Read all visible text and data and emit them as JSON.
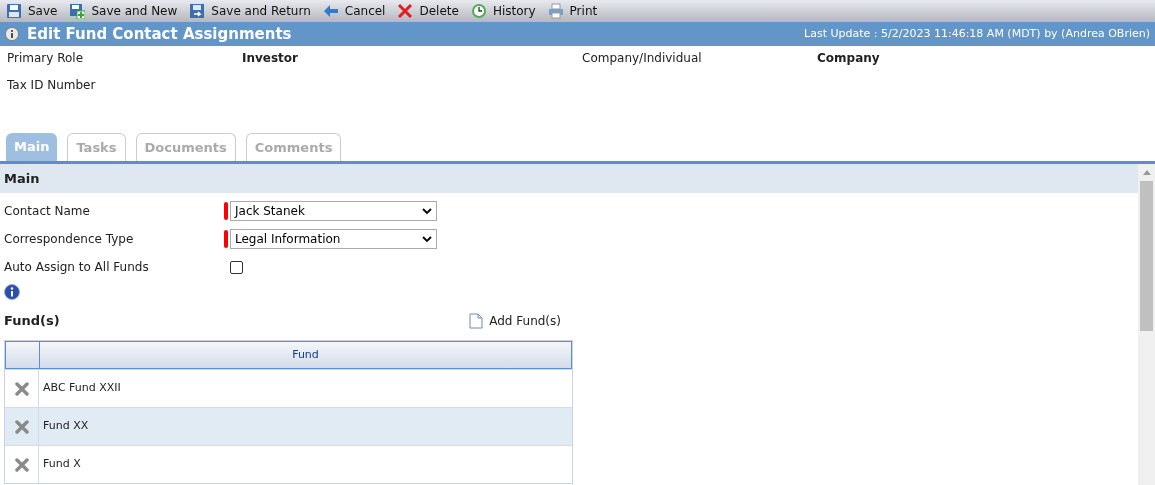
{
  "toolbar": [
    {
      "kind": "save",
      "label": "Save"
    },
    {
      "kind": "save_new",
      "label": "Save and New"
    },
    {
      "kind": "save_return",
      "label": "Save and Return"
    },
    {
      "kind": "cancel",
      "label": "Cancel"
    },
    {
      "kind": "delete",
      "label": "Delete"
    },
    {
      "kind": "history",
      "label": "History"
    },
    {
      "kind": "print",
      "label": "Print"
    }
  ],
  "title": "Edit Fund Contact Assignments",
  "last_update": "Last Update : 5/2/2023 11:46:18 AM (MDT) by (Andrea OBrien)",
  "info": [
    {
      "label": "Primary Role",
      "value": "Investor"
    },
    {
      "label": "Company/Individual",
      "value": "Company"
    },
    {
      "label": "Tax ID Number"
    }
  ],
  "tabs": [
    {
      "label": "Main",
      "selected": true
    },
    {
      "label": "Tasks",
      "selected": false
    },
    {
      "label": "Documents",
      "selected": false
    },
    {
      "label": "Comments",
      "selected": false
    }
  ],
  "section_title": "Main",
  "fields": [
    {
      "kind": "select",
      "label": "Contact Name",
      "value": "Jack Stanek",
      "required": true
    },
    {
      "kind": "select",
      "label": "Correspondence Type",
      "value": "Legal Information",
      "required": true
    },
    {
      "kind": "checkbox",
      "label": "Auto Assign to All Funds",
      "checked": false
    }
  ],
  "funds": {
    "title": "Fund(s)",
    "add_label": "Add Fund(s)",
    "columns": [
      "Fund"
    ],
    "rows": [
      {
        "fund": "ABC Fund XXII",
        "selected": false
      },
      {
        "fund": "Fund XX",
        "selected": true
      },
      {
        "fund": "Fund X",
        "selected": false
      }
    ]
  }
}
